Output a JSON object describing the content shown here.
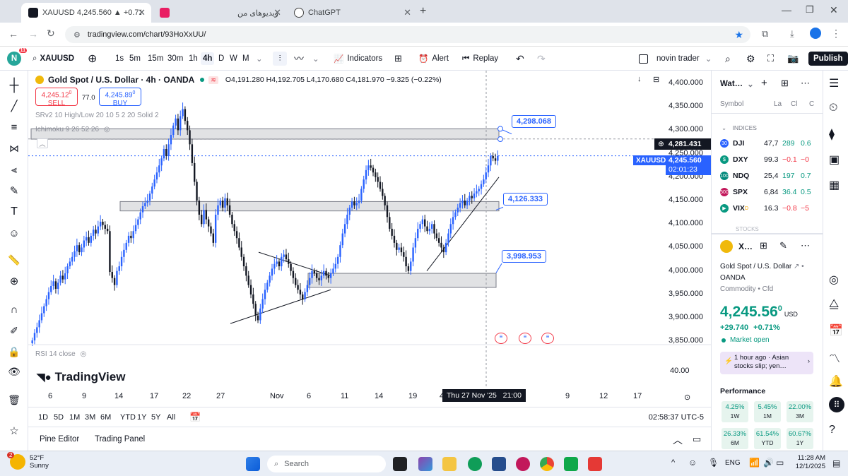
{
  "browser": {
    "tabs": [
      {
        "title": "XAUUSD 4,245.560 ▲ +0.71% n",
        "active": true
      },
      {
        "title": "ویدیوهای من",
        "active": false
      },
      {
        "title": "ChatGPT",
        "active": false
      }
    ],
    "url": "tradingview.com/chart/93HoXxUU/"
  },
  "toolbar": {
    "symbol": "XAUUSD",
    "avatar_letter": "N",
    "avatar_badge": "11",
    "intervals": [
      "1s",
      "5m",
      "15m",
      "30m",
      "1h",
      "4h",
      "D",
      "W",
      "M"
    ],
    "active_interval": "4h",
    "indicators_label": "Indicators",
    "alert_label": "Alert",
    "replay_label": "Replay",
    "layout_name": "novin trader",
    "publish_label": "Publish"
  },
  "legend": {
    "title": "Gold Spot / U.S. Dollar · 4h · OANDA",
    "ohlc": "O4,191.280 H4,192.705 L4,170.680 C4,181.970 −9.325 (−0.22%)",
    "sell_price": "4,245.12",
    "sell_sup": "0",
    "sell_label": "SELL",
    "spread": "77.0",
    "buy_price": "4,245.89",
    "buy_sup": "0",
    "buy_label": "BUY",
    "indicator1": "SRv2 10 High/Low 20 10 5 2 20 Solid 2",
    "indicator2": "Ichimoku 9 26 52 26",
    "rsi_label": "RSI 14 close"
  },
  "chart_data": {
    "type": "candlestick",
    "symbol": "XAUUSD",
    "timeframe": "4h",
    "y_axis_ticks": [
      "4,400.000",
      "4,350.000",
      "4,300.000",
      "4,250.000",
      "4,200.000",
      "4,150.000",
      "4,100.000",
      "4,050.000",
      "4,000.000",
      "3,950.000",
      "3,900.000",
      "3,850.000"
    ],
    "ylim": [
      3840,
      4415
    ],
    "rsi_tick": "40.00",
    "x_axis_ticks": [
      "6",
      "9",
      "14",
      "17",
      "22",
      "27",
      "Nov",
      "6",
      "11",
      "14",
      "19",
      "4",
      "9",
      "12",
      "17"
    ],
    "crosshair_time": "Thu 27 Nov '25   21:00",
    "current_price": "4,245.560",
    "countdown": "02:01:23",
    "cursor_price": "4,281.431",
    "price_label_symbol": "XAUUSD",
    "annotations": [
      "4,298.068",
      "4,126.333",
      "3,998.953"
    ],
    "zones": [
      {
        "from": 4281,
        "to": 4303
      },
      {
        "from": 4128,
        "to": 4148
      },
      {
        "from": 3965,
        "to": 3995
      }
    ],
    "close_series": [
      3852,
      3868,
      3880,
      3895,
      3910,
      3925,
      3940,
      3955,
      3968,
      3978,
      3962,
      3975,
      3990,
      3982,
      3995,
      4010,
      4020,
      4030,
      4042,
      4055,
      4040,
      4050,
      4065,
      4072,
      4060,
      4075,
      4088,
      4080,
      4095,
      4105,
      4098,
      4090,
      4085,
      3998,
      3985,
      3970,
      4000,
      4010,
      4030,
      4045,
      4060,
      4075,
      4070,
      4085,
      4098,
      4110,
      4125,
      4138,
      4145,
      4150,
      4165,
      4180,
      4195,
      4210,
      4225,
      4240,
      4260,
      4245,
      4270,
      4290,
      4310,
      4325,
      4300,
      4330,
      4345,
      4320,
      4300,
      4270,
      4230,
      4190,
      4150,
      4120,
      4100,
      4130,
      4110,
      4095,
      4080,
      4060,
      4120,
      4140,
      4150,
      4135,
      4155,
      4140,
      4120,
      4100,
      4085,
      4070,
      4050,
      4030,
      4010,
      3990,
      3970,
      3950,
      3930,
      3905,
      3895,
      3920,
      3940,
      3960,
      3975,
      3990,
      4005,
      4015,
      4020,
      4010,
      4030,
      4035,
      4025,
      4015,
      4000,
      3985,
      3970,
      3960,
      3950,
      3940,
      3955,
      3970,
      3985,
      4000,
      3995,
      3985,
      3980,
      3990,
      4000,
      3990,
      3985,
      3995,
      4005,
      4015,
      4030,
      4055,
      4080,
      4100,
      4120,
      4135,
      4148,
      4140,
      4145,
      4150,
      4175,
      4195,
      4215,
      4225,
      4220,
      4210,
      4200,
      4190,
      4175,
      4160,
      4140,
      4115,
      4090,
      4075,
      4060,
      4045,
      4050,
      4040,
      4030,
      4010,
      4000,
      4020,
      4050,
      4070,
      4090,
      4100,
      4110,
      4095,
      4085,
      4090,
      4100,
      4080,
      4070,
      4060,
      4050,
      4040,
      4060,
      4080,
      4100,
      4115,
      4125,
      4135,
      4145,
      4150,
      4140,
      4150,
      4160,
      4155,
      4165,
      4170,
      4175,
      4185,
      4195,
      4210,
      4225,
      4245,
      4240,
      4235,
      4245
    ]
  },
  "bottom_bar": {
    "ranges": [
      "1D",
      "5D",
      "1M",
      "3M",
      "6M",
      "YTD",
      "1Y",
      "5Y",
      "All"
    ],
    "time": "02:58:37 UTC-5"
  },
  "panels": {
    "pine_editor": "Pine Editor",
    "trading_panel": "Trading Panel"
  },
  "branding": {
    "name": "TradingView"
  },
  "watchlist": {
    "title": "Wat…",
    "col_symbol": "Symbol",
    "col_last": "La",
    "col_chg": "Cl",
    "col_chgp": "C",
    "section": "INDICES",
    "section2": "STOCKS",
    "rows": [
      {
        "symbol": "DJI",
        "last": "47,7",
        "chg": "289",
        "chgp": "0.6",
        "color": "#2962ff",
        "badge": "30",
        "up": true
      },
      {
        "symbol": "DXY",
        "last": "99.3",
        "chg": "−0.1",
        "chgp": "−0",
        "color": "#089981",
        "badge": "$",
        "up": false
      },
      {
        "symbol": "NDQ",
        "last": "25,4",
        "chg": "197",
        "chgp": "0.7",
        "color": "#00897b",
        "badge": "100",
        "up": true
      },
      {
        "symbol": "SPX",
        "last": "6,84",
        "chg": "36.4",
        "chgp": "0.5",
        "color": "#c2185b",
        "badge": "500",
        "up": true
      },
      {
        "symbol": "VIX",
        "last": "16.3",
        "chg": "−0.8",
        "chgp": "−5",
        "color": "#089981",
        "badge": "▶",
        "up": false,
        "flag": "D"
      }
    ]
  },
  "details": {
    "symbol_short": "X…",
    "name": "Gold Spot / U.S. Dollar",
    "exchange": "OANDA",
    "category": "Commodity • Cfd",
    "price": "4,245.56",
    "price_sup": "0",
    "currency": "USD",
    "change": "+29.740",
    "change_pct": "+0.71%",
    "market_status": "Market open",
    "news_time": "1 hour ago · Asian",
    "news_text": "stocks slip; yen…",
    "performance_title": "Performance",
    "performance": [
      {
        "value": "4.25%",
        "label": "1W"
      },
      {
        "value": "5.45%",
        "label": "1M"
      },
      {
        "value": "22.00%",
        "label": "3M"
      },
      {
        "value": "26.33%",
        "label": "6M"
      },
      {
        "value": "61.54%",
        "label": "YTD"
      },
      {
        "value": "60.67%",
        "label": "1Y"
      }
    ]
  },
  "taskbar": {
    "weather_temp": "52°F",
    "weather_desc": "Sunny",
    "weather_badge": "2",
    "search": "Search",
    "lang": "ENG",
    "time": "11:28 AM",
    "date": "12/1/2025"
  }
}
